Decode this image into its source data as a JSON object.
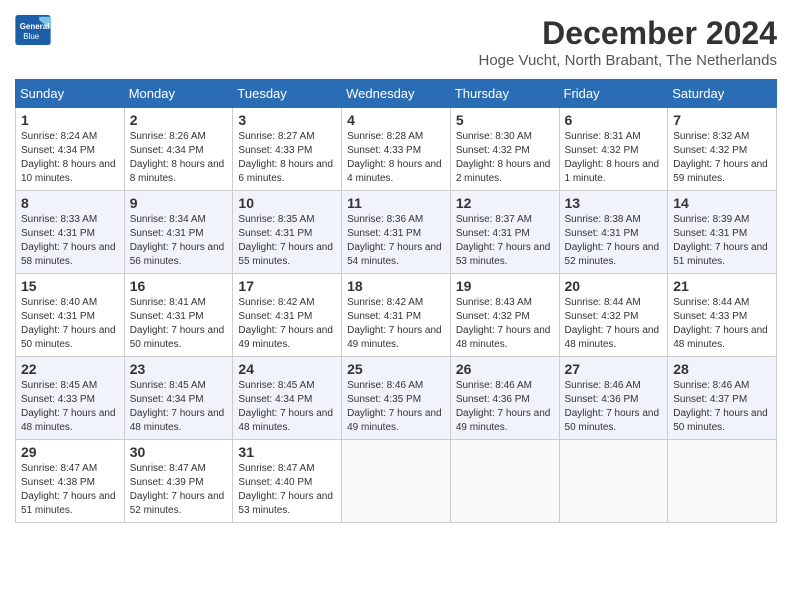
{
  "logo": {
    "line1": "General",
    "line2": "Blue"
  },
  "title": "December 2024",
  "location": "Hoge Vucht, North Brabant, The Netherlands",
  "weekdays": [
    "Sunday",
    "Monday",
    "Tuesday",
    "Wednesday",
    "Thursday",
    "Friday",
    "Saturday"
  ],
  "weeks": [
    [
      {
        "day": "1",
        "sunrise": "8:24 AM",
        "sunset": "4:34 PM",
        "daylight": "8 hours and 10 minutes."
      },
      {
        "day": "2",
        "sunrise": "8:26 AM",
        "sunset": "4:34 PM",
        "daylight": "8 hours and 8 minutes."
      },
      {
        "day": "3",
        "sunrise": "8:27 AM",
        "sunset": "4:33 PM",
        "daylight": "8 hours and 6 minutes."
      },
      {
        "day": "4",
        "sunrise": "8:28 AM",
        "sunset": "4:33 PM",
        "daylight": "8 hours and 4 minutes."
      },
      {
        "day": "5",
        "sunrise": "8:30 AM",
        "sunset": "4:32 PM",
        "daylight": "8 hours and 2 minutes."
      },
      {
        "day": "6",
        "sunrise": "8:31 AM",
        "sunset": "4:32 PM",
        "daylight": "8 hours and 1 minute."
      },
      {
        "day": "7",
        "sunrise": "8:32 AM",
        "sunset": "4:32 PM",
        "daylight": "7 hours and 59 minutes."
      }
    ],
    [
      {
        "day": "8",
        "sunrise": "8:33 AM",
        "sunset": "4:31 PM",
        "daylight": "7 hours and 58 minutes."
      },
      {
        "day": "9",
        "sunrise": "8:34 AM",
        "sunset": "4:31 PM",
        "daylight": "7 hours and 56 minutes."
      },
      {
        "day": "10",
        "sunrise": "8:35 AM",
        "sunset": "4:31 PM",
        "daylight": "7 hours and 55 minutes."
      },
      {
        "day": "11",
        "sunrise": "8:36 AM",
        "sunset": "4:31 PM",
        "daylight": "7 hours and 54 minutes."
      },
      {
        "day": "12",
        "sunrise": "8:37 AM",
        "sunset": "4:31 PM",
        "daylight": "7 hours and 53 minutes."
      },
      {
        "day": "13",
        "sunrise": "8:38 AM",
        "sunset": "4:31 PM",
        "daylight": "7 hours and 52 minutes."
      },
      {
        "day": "14",
        "sunrise": "8:39 AM",
        "sunset": "4:31 PM",
        "daylight": "7 hours and 51 minutes."
      }
    ],
    [
      {
        "day": "15",
        "sunrise": "8:40 AM",
        "sunset": "4:31 PM",
        "daylight": "7 hours and 50 minutes."
      },
      {
        "day": "16",
        "sunrise": "8:41 AM",
        "sunset": "4:31 PM",
        "daylight": "7 hours and 50 minutes."
      },
      {
        "day": "17",
        "sunrise": "8:42 AM",
        "sunset": "4:31 PM",
        "daylight": "7 hours and 49 minutes."
      },
      {
        "day": "18",
        "sunrise": "8:42 AM",
        "sunset": "4:31 PM",
        "daylight": "7 hours and 49 minutes."
      },
      {
        "day": "19",
        "sunrise": "8:43 AM",
        "sunset": "4:32 PM",
        "daylight": "7 hours and 48 minutes."
      },
      {
        "day": "20",
        "sunrise": "8:44 AM",
        "sunset": "4:32 PM",
        "daylight": "7 hours and 48 minutes."
      },
      {
        "day": "21",
        "sunrise": "8:44 AM",
        "sunset": "4:33 PM",
        "daylight": "7 hours and 48 minutes."
      }
    ],
    [
      {
        "day": "22",
        "sunrise": "8:45 AM",
        "sunset": "4:33 PM",
        "daylight": "7 hours and 48 minutes."
      },
      {
        "day": "23",
        "sunrise": "8:45 AM",
        "sunset": "4:34 PM",
        "daylight": "7 hours and 48 minutes."
      },
      {
        "day": "24",
        "sunrise": "8:45 AM",
        "sunset": "4:34 PM",
        "daylight": "7 hours and 48 minutes."
      },
      {
        "day": "25",
        "sunrise": "8:46 AM",
        "sunset": "4:35 PM",
        "daylight": "7 hours and 49 minutes."
      },
      {
        "day": "26",
        "sunrise": "8:46 AM",
        "sunset": "4:36 PM",
        "daylight": "7 hours and 49 minutes."
      },
      {
        "day": "27",
        "sunrise": "8:46 AM",
        "sunset": "4:36 PM",
        "daylight": "7 hours and 50 minutes."
      },
      {
        "day": "28",
        "sunrise": "8:46 AM",
        "sunset": "4:37 PM",
        "daylight": "7 hours and 50 minutes."
      }
    ],
    [
      {
        "day": "29",
        "sunrise": "8:47 AM",
        "sunset": "4:38 PM",
        "daylight": "7 hours and 51 minutes."
      },
      {
        "day": "30",
        "sunrise": "8:47 AM",
        "sunset": "4:39 PM",
        "daylight": "7 hours and 52 minutes."
      },
      {
        "day": "31",
        "sunrise": "8:47 AM",
        "sunset": "4:40 PM",
        "daylight": "7 hours and 53 minutes."
      },
      null,
      null,
      null,
      null
    ]
  ]
}
